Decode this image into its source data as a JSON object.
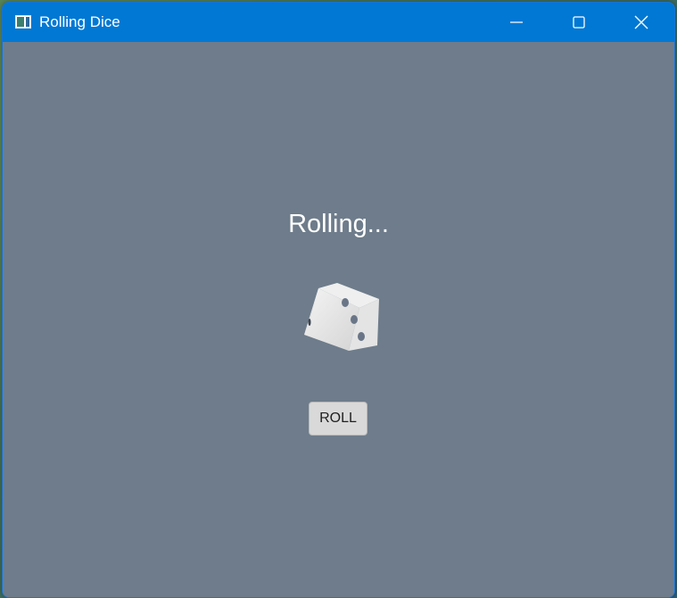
{
  "window": {
    "title": "Rolling Dice",
    "icon": "app-window-icon",
    "controls": {
      "minimize": "minimize-icon",
      "maximize": "maximize-icon",
      "close": "close-icon"
    }
  },
  "main": {
    "status": "Rolling...",
    "dice_icon": "dice-icon",
    "roll_label": "ROLL"
  },
  "colors": {
    "titlebar": "#0078d4",
    "background": "#6e7c8b",
    "button": "#d9d9d9",
    "text": "#ffffff"
  }
}
